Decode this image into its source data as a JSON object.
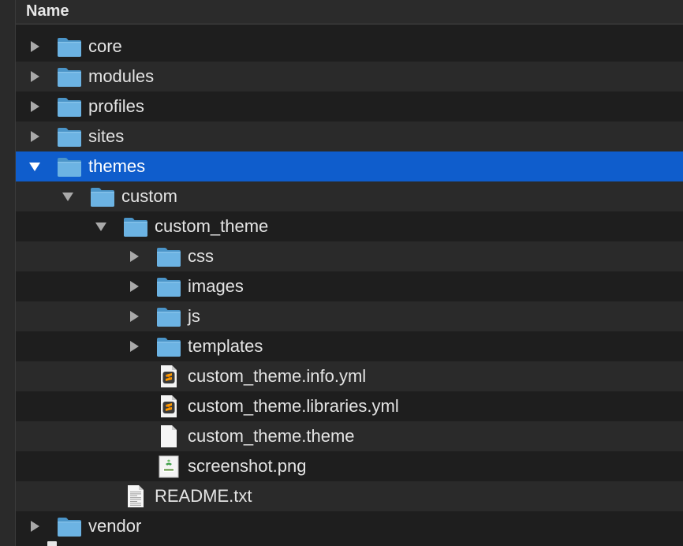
{
  "header": {
    "name_label": "Name"
  },
  "colors": {
    "selection": "#0f5dcc",
    "row_alt": "#2a2a2a",
    "row_base": "#1e1e1e",
    "folder": "#6cb3e3",
    "text": "#e4e4e4"
  },
  "rows": [
    {
      "label": "core",
      "kind": "folder",
      "depth": 0,
      "disclosure": "collapsed",
      "selected": false
    },
    {
      "label": "modules",
      "kind": "folder",
      "depth": 0,
      "disclosure": "collapsed",
      "selected": false
    },
    {
      "label": "profiles",
      "kind": "folder",
      "depth": 0,
      "disclosure": "collapsed",
      "selected": false
    },
    {
      "label": "sites",
      "kind": "folder",
      "depth": 0,
      "disclosure": "collapsed",
      "selected": false
    },
    {
      "label": "themes",
      "kind": "folder",
      "depth": 0,
      "disclosure": "expanded",
      "selected": true
    },
    {
      "label": "custom",
      "kind": "folder",
      "depth": 1,
      "disclosure": "expanded",
      "selected": false
    },
    {
      "label": "custom_theme",
      "kind": "folder",
      "depth": 2,
      "disclosure": "expanded",
      "selected": false
    },
    {
      "label": "css",
      "kind": "folder",
      "depth": 3,
      "disclosure": "collapsed",
      "selected": false
    },
    {
      "label": "images",
      "kind": "folder",
      "depth": 3,
      "disclosure": "collapsed",
      "selected": false
    },
    {
      "label": "js",
      "kind": "folder",
      "depth": 3,
      "disclosure": "collapsed",
      "selected": false
    },
    {
      "label": "templates",
      "kind": "folder",
      "depth": 3,
      "disclosure": "collapsed",
      "selected": false
    },
    {
      "label": "custom_theme.info.yml",
      "kind": "sublime",
      "depth": 3,
      "disclosure": "none",
      "selected": false
    },
    {
      "label": "custom_theme.libraries.yml",
      "kind": "sublime",
      "depth": 3,
      "disclosure": "none",
      "selected": false
    },
    {
      "label": "custom_theme.theme",
      "kind": "blank",
      "depth": 3,
      "disclosure": "none",
      "selected": false
    },
    {
      "label": "screenshot.png",
      "kind": "image",
      "depth": 3,
      "disclosure": "none",
      "selected": false
    },
    {
      "label": "README.txt",
      "kind": "text",
      "depth": 2,
      "disclosure": "none",
      "selected": false
    },
    {
      "label": "vendor",
      "kind": "folder",
      "depth": 0,
      "disclosure": "collapsed",
      "selected": false
    }
  ],
  "icon_names": {
    "folder": "folder-icon",
    "sublime": "sublime-file-icon",
    "blank": "document-icon",
    "image": "twig-image-icon",
    "text": "text-file-icon",
    "collapsed": "disclosure-collapsed-icon",
    "expanded": "disclosure-expanded-icon"
  }
}
